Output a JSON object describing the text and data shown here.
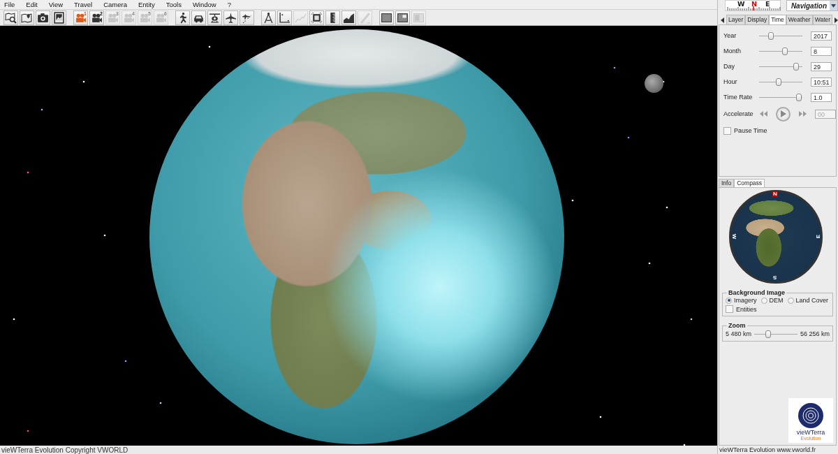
{
  "menu": [
    {
      "label": "File"
    },
    {
      "label": "Edit"
    },
    {
      "label": "View"
    },
    {
      "label": "Travel"
    },
    {
      "label": "Camera"
    },
    {
      "label": "Entity"
    },
    {
      "label": "Tools"
    },
    {
      "label": "Window"
    },
    {
      "label": "?"
    }
  ],
  "toolbar": [
    [
      {
        "kind": "map-search",
        "disabled": false
      },
      {
        "kind": "map-pin",
        "disabled": false
      },
      {
        "kind": "camera",
        "disabled": false
      },
      {
        "kind": "image-frame",
        "disabled": false
      }
    ],
    [
      {
        "kind": "movie-camera",
        "number": "1",
        "selected": true,
        "disabled": false
      },
      {
        "kind": "movie-camera",
        "number": "2",
        "selected": false,
        "disabled": false
      },
      {
        "kind": "movie-camera",
        "number": "3",
        "selected": false,
        "disabled": true
      },
      {
        "kind": "movie-camera",
        "number": "4",
        "selected": false,
        "disabled": true
      },
      {
        "kind": "movie-camera",
        "number": "5",
        "selected": false,
        "disabled": true
      },
      {
        "kind": "movie-camera",
        "number": "6",
        "selected": false,
        "disabled": true
      }
    ],
    [
      {
        "kind": "walker",
        "disabled": false
      },
      {
        "kind": "car",
        "disabled": false
      },
      {
        "kind": "helicopter",
        "disabled": false
      },
      {
        "kind": "airplane",
        "disabled": false
      },
      {
        "kind": "route",
        "disabled": false
      }
    ],
    [
      {
        "kind": "dividers",
        "disabled": false
      },
      {
        "kind": "axes",
        "disabled": false
      },
      {
        "kind": "line-chart",
        "disabled": true
      },
      {
        "kind": "frame",
        "disabled": false
      },
      {
        "kind": "ruler",
        "disabled": false
      },
      {
        "kind": "area-chart",
        "disabled": false
      },
      {
        "kind": "pen",
        "disabled": true
      }
    ],
    [
      {
        "kind": "panel",
        "disabled": false
      },
      {
        "kind": "panel-inset",
        "disabled": false
      },
      {
        "kind": "panel-split",
        "disabled": true
      }
    ]
  ],
  "compass_strip": {
    "labels": [
      {
        "text": "W",
        "color": "#202020"
      },
      {
        "text": "N",
        "color": "#e00000"
      },
      {
        "text": "E",
        "color": "#202020"
      }
    ]
  },
  "mode_dropdown": {
    "value": "Navigation"
  },
  "top_tabs": [
    {
      "label": "Layer",
      "selected": false
    },
    {
      "label": "Display",
      "selected": false
    },
    {
      "label": "Time",
      "selected": true
    },
    {
      "label": "Weather",
      "selected": false
    },
    {
      "label": "Water",
      "selected": false
    }
  ],
  "time_panel": {
    "sliders": [
      {
        "label": "Year",
        "level": 0.28,
        "value": "2017"
      },
      {
        "label": "Month",
        "level": 0.6,
        "value": "8"
      },
      {
        "label": "Day",
        "level": 0.85,
        "value": "29"
      },
      {
        "label": "Hour",
        "level": 0.45,
        "value": "10:51"
      },
      {
        "label": "Time Rate",
        "level": 0.92,
        "value": "1.0"
      }
    ],
    "accelerate": {
      "label": "Accelerate",
      "value": "00",
      "disabled": true
    },
    "pause_time": {
      "label": "Pause Time",
      "checked": false
    }
  },
  "bottom_tabs": [
    {
      "label": "Info",
      "selected": false
    },
    {
      "label": "Compass",
      "selected": true
    }
  ],
  "compass_dial": {
    "labels": [
      "N",
      "W",
      "E",
      "S"
    ]
  },
  "background_image": {
    "title": "Background Image",
    "options": [
      {
        "label": "Imagery",
        "selected": true
      },
      {
        "label": "DEM",
        "selected": false
      },
      {
        "label": "Land Cover",
        "selected": false
      }
    ],
    "entities": {
      "label": "Entities",
      "checked": false
    }
  },
  "zoom": {
    "title": "Zoom",
    "min": "5 480 km",
    "max": "56 256 km",
    "level": 0.33
  },
  "logo": {
    "name": "vieWTerra",
    "subtitle": "Evolution"
  },
  "panel_status": "vieWTerra Evolution www.vworld.fr",
  "status_bar": {
    "text": "vieWTerra Evolution Copyright VWORLD"
  }
}
